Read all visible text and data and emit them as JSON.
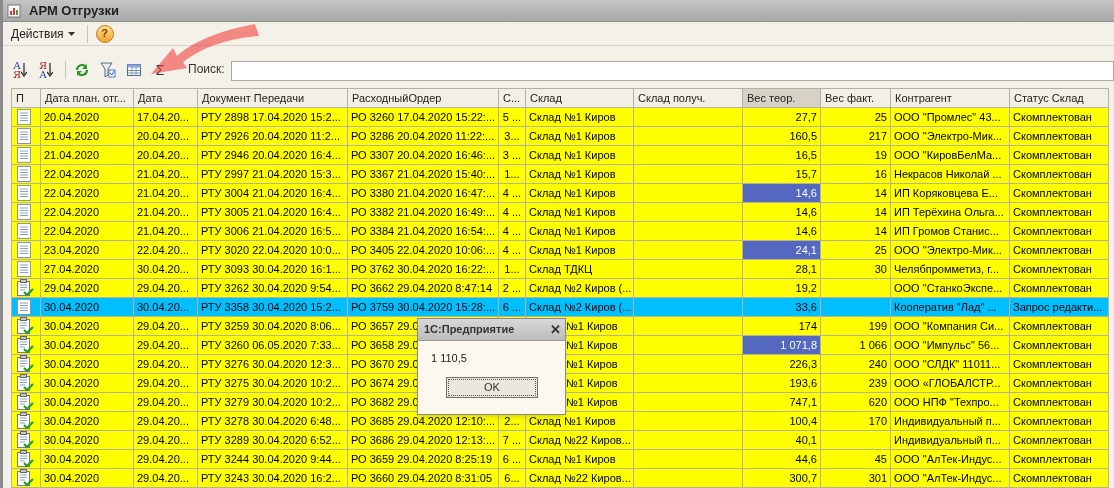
{
  "window": {
    "title": "АРМ Отгрузки"
  },
  "menu": {
    "actions": "Действия",
    "help": "?"
  },
  "toolbar": {
    "sort_buttons": [
      {
        "top": "А",
        "bottom": "Я"
      },
      {
        "top": "Я",
        "bottom": "А"
      }
    ],
    "sum": "Σ",
    "search_label": "Поиск:"
  },
  "table": {
    "columns": [
      {
        "label": "П",
        "sorted": false
      },
      {
        "label": "Дата план. отг...",
        "sorted": false
      },
      {
        "label": "Дата",
        "sorted": false
      },
      {
        "label": "Документ Передачи",
        "sorted": false
      },
      {
        "label": "РасходныйОрдер",
        "sorted": false
      },
      {
        "label": "С...",
        "sorted": false
      },
      {
        "label": "Склад",
        "sorted": false
      },
      {
        "label": "Склад получ.",
        "sorted": false
      },
      {
        "label": "Вес теор.",
        "sorted": true
      },
      {
        "label": "Вес факт.",
        "sorted": false
      },
      {
        "label": "Контрагент",
        "sorted": false
      },
      {
        "label": "Статус Склад",
        "sorted": false
      }
    ],
    "rows": [
      {
        "kind": "document",
        "selected": false,
        "covered": false,
        "highlighted": false,
        "plan_date": "20.04.2020",
        "date": "17.04.20...",
        "document": "РТУ 2898 17.04.2020 15:2...",
        "order": "РО 3260 17.04.2020 15:22:...",
        "column_6": "5 ...",
        "warehouse": "Склад №1 Киров",
        "weight_theor": "27,7",
        "weight_fact": "25",
        "counterparty": "ООО \"Промлес\" 43...",
        "status": "Скомплектован"
      },
      {
        "kind": "document",
        "selected": false,
        "covered": false,
        "highlighted": false,
        "plan_date": "21.04.2020",
        "date": "20.04.20...",
        "document": "РТУ 2926 20.04.2020 11:2...",
        "order": "РО 3286 20.04.2020 11:22:...",
        "column_6": "3...",
        "warehouse": "Склад №1 Киров",
        "weight_theor": "160,5",
        "weight_fact": "217",
        "counterparty": "ООО \"Электро-Мик...",
        "status": "Скомплектован"
      },
      {
        "kind": "document",
        "selected": false,
        "covered": false,
        "highlighted": false,
        "plan_date": "21.04.2020",
        "date": "20.04.20...",
        "document": "РТУ 2946 20.04.2020 16:4...",
        "order": "РО 3307 20.04.2020 16:46:...",
        "column_6": "3 ...",
        "warehouse": "Склад №1 Киров",
        "weight_theor": "16,5",
        "weight_fact": "19",
        "counterparty": "ООО \"КировБелМа...",
        "status": "Скомплектован"
      },
      {
        "kind": "document",
        "selected": false,
        "covered": false,
        "highlighted": false,
        "plan_date": "22.04.2020",
        "date": "21.04.20...",
        "document": "РТУ 2997 21.04.2020 15:3...",
        "order": "РО 3367 21.04.2020 15:40:...",
        "column_6": "1...",
        "warehouse": "Склад №1 Киров",
        "weight_theor": "15,7",
        "weight_fact": "16",
        "counterparty": "Некрасов Николай ...",
        "status": "Скомплектован"
      },
      {
        "kind": "document",
        "selected": false,
        "covered": false,
        "highlighted": true,
        "plan_date": "22.04.2020",
        "date": "21.04.20...",
        "document": "РТУ 3004 21.04.2020 16:4...",
        "order": "РО 3380 21.04.2020 16:47:...",
        "column_6": "4 ...",
        "warehouse": "Склад №1 Киров",
        "weight_theor": "14,6",
        "weight_fact": "14",
        "counterparty": "ИП Коряковцева Е...",
        "status": "Скомплектован"
      },
      {
        "kind": "document",
        "selected": false,
        "covered": false,
        "highlighted": false,
        "plan_date": "22.04.2020",
        "date": "21.04.20...",
        "document": "РТУ 3005 21.04.2020 16:4...",
        "order": "РО 3382 21.04.2020 16:49:...",
        "column_6": "4 ...",
        "warehouse": "Склад №1 Киров",
        "weight_theor": "14,6",
        "weight_fact": "14",
        "counterparty": "ИП Терёхина Ольга...",
        "status": "Скомплектован"
      },
      {
        "kind": "document",
        "selected": false,
        "covered": false,
        "highlighted": false,
        "plan_date": "22.04.2020",
        "date": "21.04.20...",
        "document": "РТУ 3006 21.04.2020 16:5...",
        "order": "РО 3384 21.04.2020 16:54:...",
        "column_6": "4 ...",
        "warehouse": "Склад №1 Киров",
        "weight_theor": "14,6",
        "weight_fact": "14",
        "counterparty": "ИП Громов Станис...",
        "status": "Скомплектован"
      },
      {
        "kind": "document",
        "selected": false,
        "covered": false,
        "highlighted": true,
        "plan_date": "23.04.2020",
        "date": "22.04.20...",
        "document": "РТУ 3020 22.04.2020 10:0...",
        "order": "РО 3405 22.04.2020 10:06:...",
        "column_6": "4 ...",
        "warehouse": "Склад №1 Киров",
        "weight_theor": "24,1",
        "weight_fact": "25",
        "counterparty": "ООО \"Электро-Мик...",
        "status": "Скомплектован"
      },
      {
        "kind": "document",
        "selected": false,
        "covered": false,
        "highlighted": false,
        "plan_date": "27.04.2020",
        "date": "30.04.20...",
        "document": "РТУ 3093 30.04.2020 16:1...",
        "order": "РО 3762 30.04.2020 16:22:...",
        "column_6": "1...",
        "warehouse": "Склад ТДКЦ",
        "weight_theor": "28,1",
        "weight_fact": "30",
        "counterparty": "Челябпромметиз, г...",
        "status": "Скомплектован"
      },
      {
        "kind": "approved",
        "selected": false,
        "covered": false,
        "highlighted": false,
        "plan_date": "29.04.2020",
        "date": "29.04.20...",
        "document": "РТУ 3262 30.04.2020 9:54...",
        "order": "РО 3662 29.04.2020 8:47:14",
        "column_6": "2 ...",
        "warehouse": "Склад №2 Киров (...",
        "weight_theor": "19,2",
        "counterparty": "ООО \"СтанкоЭкспе...",
        "status": "Скомплектован"
      },
      {
        "kind": "document",
        "selected": true,
        "covered": false,
        "highlighted": false,
        "plan_date": "30.04.2020",
        "date": "30.04.20...",
        "document": "РТУ 3358 30.04.2020 15:2...",
        "order": "РО 3759 30.04.2020 15:28:...",
        "column_6": "6 ...",
        "warehouse": "Склад №2 Киров (...",
        "weight_theor": "33,6",
        "counterparty": "Кооператив \"Лад\" ...",
        "status": "Запрос редакти..."
      },
      {
        "kind": "approved",
        "selected": false,
        "covered": true,
        "highlighted": false,
        "plan_date": "30.04.2020",
        "date": "29.04.20...",
        "document": "РТУ 3259 30.04.2020 8:06...",
        "order": "РО 3657 29.0",
        "warehouse": "№1 Киров",
        "weight_theor": "174",
        "weight_fact": "199",
        "counterparty": "ООО \"Компания Си...",
        "status": "Скомплектован"
      },
      {
        "kind": "approved",
        "selected": false,
        "covered": true,
        "highlighted": true,
        "plan_date": "30.04.2020",
        "date": "29.04.20...",
        "document": "РТУ 3260 06.05.2020 7:33...",
        "order": "РО 3658 29.0",
        "warehouse": "№1 Киров",
        "weight_theor": "1 071,8",
        "weight_fact": "1 066",
        "counterparty": "ООО \"Импульс\"  56...",
        "status": "Скомплектован"
      },
      {
        "kind": "approved",
        "selected": false,
        "covered": true,
        "highlighted": false,
        "plan_date": "30.04.2020",
        "date": "29.04.20...",
        "document": "РТУ 3276 30.04.2020 12:3...",
        "order": "РО 3670 29.0",
        "warehouse": "№1 Киров",
        "weight_theor": "226,3",
        "weight_fact": "240",
        "counterparty": "ООО \"СЛДК\" 11011...",
        "status": "Скомплектован"
      },
      {
        "kind": "approved",
        "selected": false,
        "covered": true,
        "highlighted": false,
        "plan_date": "30.04.2020",
        "date": "29.04.20...",
        "document": "РТУ 3275 30.04.2020 10:2...",
        "order": "РО 3674 29.0",
        "warehouse": "№1 Киров",
        "weight_theor": "193,6",
        "weight_fact": "239",
        "counterparty": "ООО «ГЛОБАЛСТР...",
        "status": "Скомплектован"
      },
      {
        "kind": "approved",
        "selected": false,
        "covered": true,
        "highlighted": false,
        "plan_date": "30.04.2020",
        "date": "29.04.20...",
        "document": "РТУ 3279 30.04.2020 10:2...",
        "order": "РО 3682 29.0",
        "warehouse": "№1 Киров",
        "weight_theor": "747,1",
        "weight_fact": "620",
        "counterparty": "ООО НПФ \"Техпро...",
        "status": "Скомплектован"
      },
      {
        "kind": "approved",
        "selected": false,
        "covered": false,
        "highlighted": false,
        "plan_date": "30.04.2020",
        "date": "29.04.20...",
        "document": "РТУ 3278 30.04.2020 6:48...",
        "order": "РО 3685 29.04.2020 12:10:...",
        "column_6": "2...",
        "warehouse": "Склад №1 Киров",
        "weight_theor": "100,4",
        "weight_fact": "170",
        "counterparty": "Индивидуальный п...",
        "status": "Скомплектован"
      },
      {
        "kind": "approved",
        "selected": false,
        "covered": false,
        "highlighted": false,
        "plan_date": "30.04.2020",
        "date": "29.04.20...",
        "document": "РТУ 3289 30.04.2020 6:52...",
        "order": "РО 3686 29.04.2020 12:13:...",
        "column_6": "7 ...",
        "warehouse": "Склад №22 Киров...",
        "weight_theor": "40,1",
        "counterparty": "Индивидуальный п...",
        "status": "Скомплектован"
      },
      {
        "kind": "approved",
        "selected": false,
        "covered": false,
        "highlighted": false,
        "plan_date": "30.04.2020",
        "date": "29.04.20...",
        "document": "РТУ 3244 30.04.2020 9:44...",
        "order": "РО 3659 29.04.2020 8:25:19",
        "column_6": "6 ...",
        "warehouse": "Склад №1 Киров",
        "weight_theor": "44,6",
        "weight_fact": "45",
        "counterparty": "ООО \"АлТек-Индус...",
        "status": "Скомплектован"
      },
      {
        "kind": "approved",
        "selected": false,
        "covered": false,
        "highlighted": false,
        "plan_date": "30.04.2020",
        "date": "29.04.20...",
        "document": "РТУ 3243 30.04.2020 16:2...",
        "order": "РО 3660 29.04.2020 8:31:05",
        "column_6": "6...",
        "warehouse": "Склад №22 Киров...",
        "weight_theor": "300,7",
        "weight_fact": "301",
        "counterparty": "ООО \"АлТек-Индус...",
        "status": "Скомплектован"
      }
    ]
  },
  "dialog": {
    "title": "1С:Предприятие",
    "close": "✕",
    "message": "1 110,5",
    "ok": "OK"
  }
}
